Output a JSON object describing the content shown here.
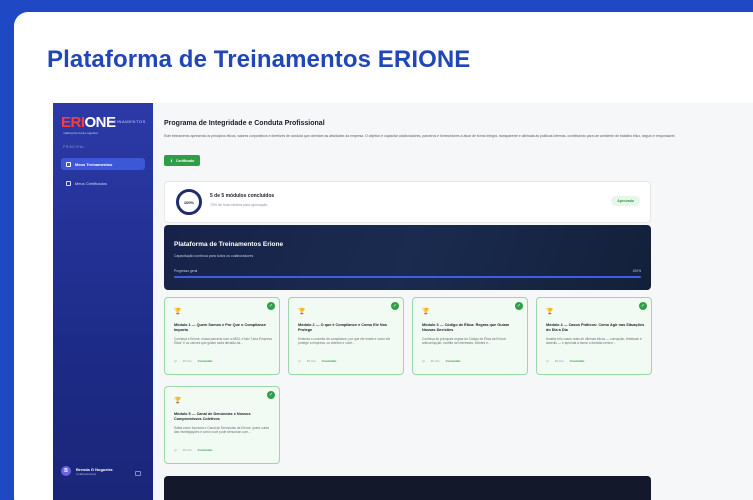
{
  "outer": {
    "title": "Plataforma de Treinamentos ERIONE"
  },
  "sidebar": {
    "logo_er": "ERI",
    "logo_one": "ONE",
    "logo_tag": "TREINAMENTOS",
    "logo_sub": "making the future together",
    "section": "PRINCIPAL",
    "items": [
      {
        "label": "Meus Treinamentos",
        "active": true
      },
      {
        "label": "Meus Certificados",
        "active": false
      }
    ],
    "user": {
      "initial": "B",
      "name": "Brenda G Nogueira",
      "role": "Colaborador(a)"
    }
  },
  "main": {
    "title": "Programa de Integridade e Conduta Profissional",
    "description": "Este treinamento apresenta os princípios éticos, valores corporativos e diretrizes de conduta que orientam as atividades da empresa. O objetivo é capacitar colaboradores, parceiros e fornecedores a atuar de forma íntegra, transparente e alinhada às políticas internas, contribuindo para um ambiente de trabalho ético, seguro e responsável.",
    "certificate_button": "Certificado",
    "progress": {
      "percent_label": "100%",
      "summary": "5 de 5 módulos concluídos",
      "min_note": "70% de nota mínima para aprovação",
      "status": "Aprovado"
    },
    "hero": {
      "title": "Plataforma de Treinamentos Erione",
      "subtitle": "Capacitação contínua para todos os colaboradores",
      "progress_label": "Progresso geral",
      "progress_value": "100%",
      "progress_fraction": 1.0
    },
    "modules": [
      {
        "title": "Módulo 1 — Quem Somos e Por Que o Compliance Importa",
        "desc": "Conheça a Erione, nossa parceria com a ABCL e falo \"Uma Empresa Ética\" e os valores que guiam cada decisão da...",
        "time": "15 min",
        "status": "Concluído"
      },
      {
        "title": "Módulo 2 — O que é Compliance e Como Ele Nos Protege",
        "desc": "Entenda o conceito de compliance, por que ele existe e como ele protege a empresa, os clientes e você...",
        "time": "15 min",
        "status": "Concluído"
      },
      {
        "title": "Módulo 3 — Código de Ética: Regras que Guiam Nossas Decisões",
        "desc": "Conheça as principais regras do Código de Ética da Erione: anticorrupção, conflito de interesses, brindes e...",
        "time": "20 min",
        "status": "Concluído"
      },
      {
        "title": "Módulo 4 — Casos Práticos: Como Agir nas Situações do Dia a Dia",
        "desc": "Analise três casos reais de dilemas éticos — corrupção, feedback e assédio — e aprenda a tomar a decisão certa e...",
        "time": "20 min",
        "status": "Concluído"
      },
      {
        "title": "Módulo 5 — Canal de Denúncias e Nossos Compromissos Coletivos",
        "desc": "Saiba como funciona o Canal de Denúncias da Erione, quem cuida das investigações e como você pode denunciar com...",
        "time": "15 min",
        "status": "Concluído"
      }
    ]
  },
  "colors": {
    "brand_blue": "#1f47b8",
    "success": "#2f9f47",
    "logo_red": "#ff3b3b"
  }
}
